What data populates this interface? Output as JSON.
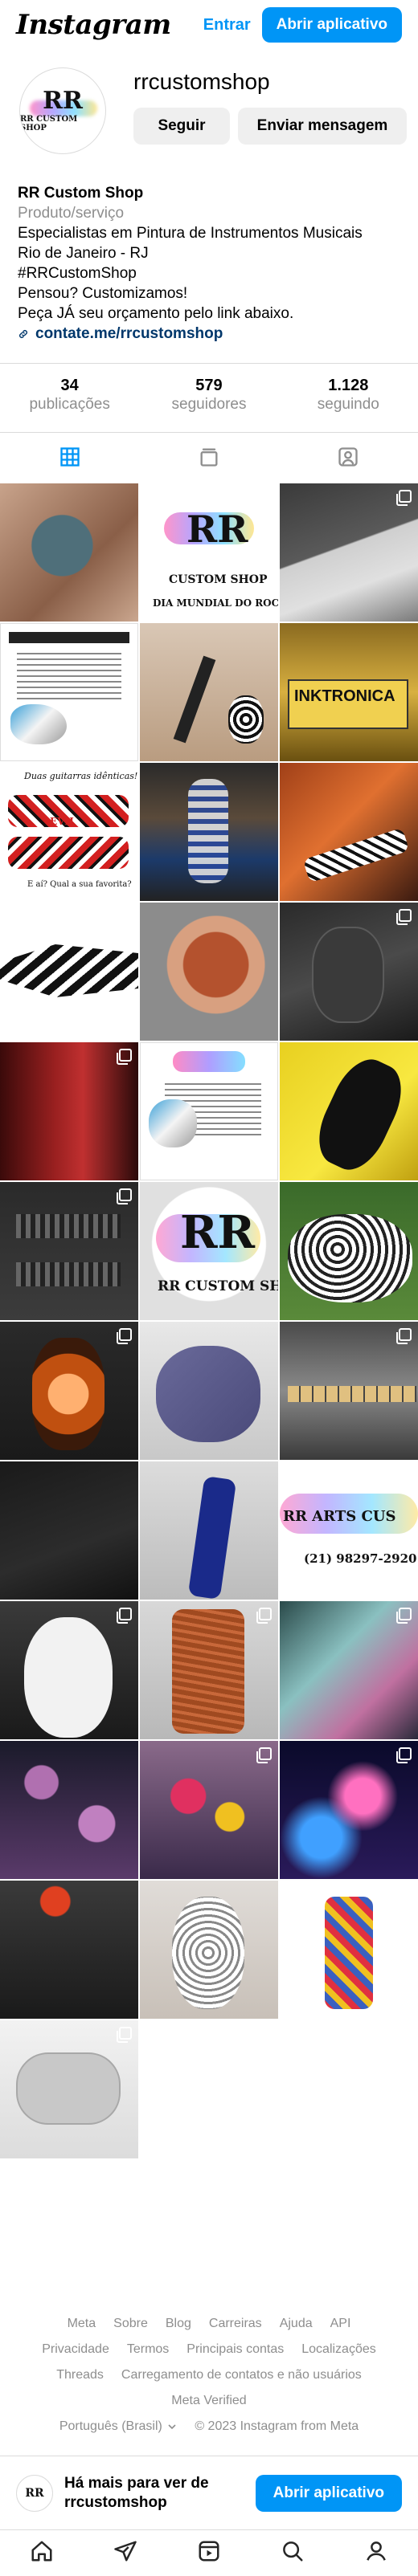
{
  "topbar": {
    "logo": "Instagram",
    "login_label": "Entrar",
    "open_app_label": "Abrir aplicativo"
  },
  "profile": {
    "avatar_monogram": "RR",
    "avatar_caption": "RR CUSTOM SHOP",
    "username": "rrcustomshop",
    "follow_label": "Seguir",
    "message_label": "Enviar mensagem"
  },
  "bio": {
    "name": "RR Custom Shop",
    "category": "Produto/serviço",
    "lines": [
      "Especialistas em Pintura de Instrumentos Musicais",
      "Rio de Janeiro - RJ",
      "#RRCustomShop",
      "Pensou? Customizamos!",
      "Peça JÁ seu orçamento pelo link abaixo."
    ],
    "link": "contate.me/rrcustomshop"
  },
  "stats": [
    {
      "value": "34",
      "label": "publicações"
    },
    {
      "value": "579",
      "label": "seguidores"
    },
    {
      "value": "1.128",
      "label": "seguindo"
    }
  ],
  "tabs": [
    {
      "icon": "grid-icon",
      "active": true
    },
    {
      "icon": "reels-tv-icon",
      "active": false
    },
    {
      "icon": "tagged-icon",
      "active": false
    }
  ],
  "posts": {
    "post2_caption": "CUSTOM SHOP",
    "post2_subcaption": "DIA MUNDIAL DO ROCK",
    "post6_label": "INKTRONICA",
    "post7_top": "Duas guitarras idênticas!",
    "post7_bottom": "E aí? Qual a sua favorita?",
    "post7_badge": "EVH",
    "post17_caption": "RR CUSTOM SHOP",
    "post24_caption": "RR ARTS CUS",
    "post24_phone": "(21) 98297-2920"
  },
  "footer": {
    "links_row1": [
      "Meta",
      "Sobre",
      "Blog",
      "Carreiras",
      "Ajuda",
      "API"
    ],
    "links_row2": [
      "Privacidade",
      "Termos",
      "Principais contas",
      "Localizações"
    ],
    "links_row3": [
      "Threads",
      "Carregamento de contatos e não usuários"
    ],
    "links_row4": [
      "Meta Verified"
    ],
    "language": "Português (Brasil)",
    "copyright": "© 2023 Instagram from Meta"
  },
  "banner": {
    "text": "Há mais para ver de rrcustomshop",
    "button_label": "Abrir aplicativo"
  },
  "colors": {
    "accent": "#0095f6",
    "link": "#00376b",
    "muted": "#8e8e8e",
    "divider": "#dbdbdb"
  }
}
